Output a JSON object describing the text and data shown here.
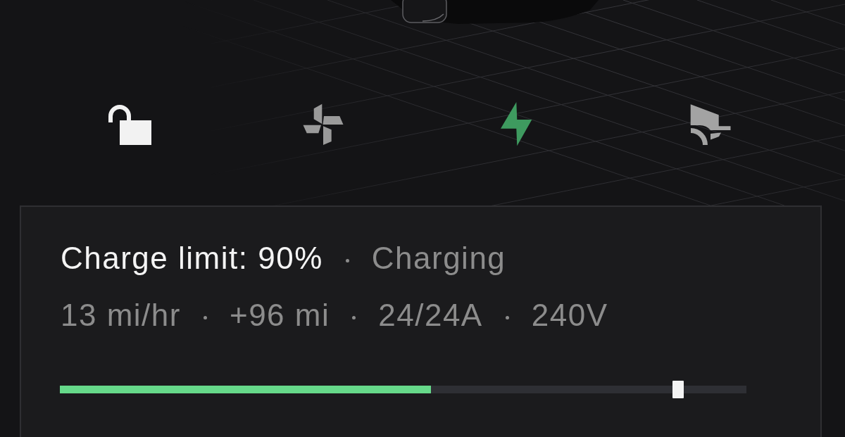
{
  "controls": [
    {
      "kind": "lock",
      "color": "#f2f2f2"
    },
    {
      "kind": "fan",
      "color": "#9a9a9a"
    },
    {
      "kind": "charge",
      "color": "#3e9a5f"
    },
    {
      "kind": "trunk",
      "color": "#a3a3a3"
    }
  ],
  "charging_panel": {
    "charge_limit": "Charge limit: 90%",
    "status": "Charging",
    "stats": [
      "13 mi/hr",
      "+96 mi",
      "24/24A",
      "240V"
    ],
    "charge_bar": {
      "level": 0.54,
      "limit": {
        "level": 0.9
      }
    }
  }
}
